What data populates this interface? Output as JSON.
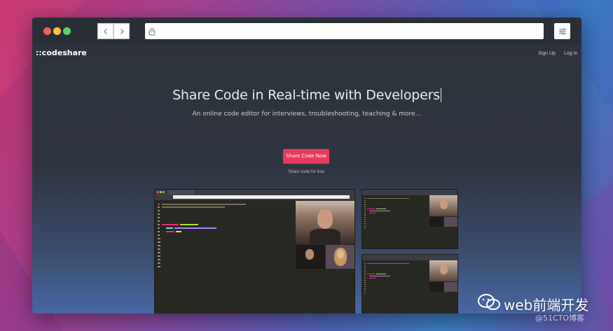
{
  "browser": {
    "back_icon": "chevron-left-icon",
    "forward_icon": "chevron-right-icon",
    "lock_icon": "lock-icon",
    "menu_icon": "sliders-icon",
    "url": ""
  },
  "site": {
    "logo": "::codeshare",
    "nav": {
      "signup": "Sign Up",
      "login": "Log In"
    }
  },
  "hero": {
    "title": "Share Code in Real-time with Developers",
    "subtitle": "An online code editor for interviews, troubleshooting, teaching & more…",
    "cta_label": "Share Code Now",
    "cta_note": "Share code for free."
  },
  "watermark": {
    "brand": "web前端开发",
    "source": "@51CTO博客"
  },
  "colors": {
    "cta": "#e8395e",
    "page_bg_top": "#2e333b",
    "page_bg_bottom": "#4767a3",
    "editor_bg": "#272822"
  }
}
